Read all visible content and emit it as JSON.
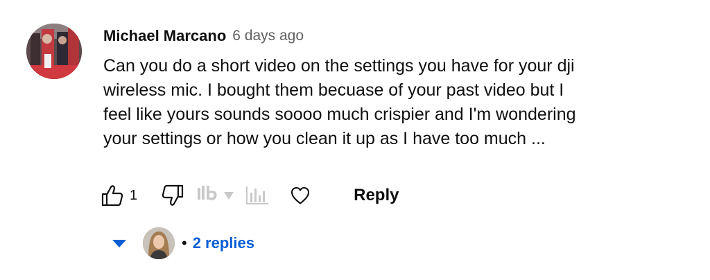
{
  "comment": {
    "author": "Michael Marcano",
    "timestamp": "6 days ago",
    "text_lines": [
      "Can you do a short video on the settings you have for your dji",
      "wireless mic. I bought them becuase of your past video but I",
      "feel like yours sounds soooo much crispier and I'm wondering",
      "your settings or how you clean it up as I have too much ..."
    ],
    "like_count": "1",
    "reply_label": "Reply"
  },
  "extension": {
    "logo": "vidIQ-icon"
  },
  "replies": {
    "separator": "•",
    "toggle_label": "2 replies"
  },
  "icons": {
    "like": "thumbs-up-icon",
    "dislike": "thumbs-down-icon",
    "stats": "bar-chart-icon",
    "heart": "heart-icon",
    "expand": "triangle-down-icon"
  },
  "colors": {
    "link": "#065fd4",
    "secondary_text": "#606060",
    "primary_text": "#0f0f0f"
  }
}
